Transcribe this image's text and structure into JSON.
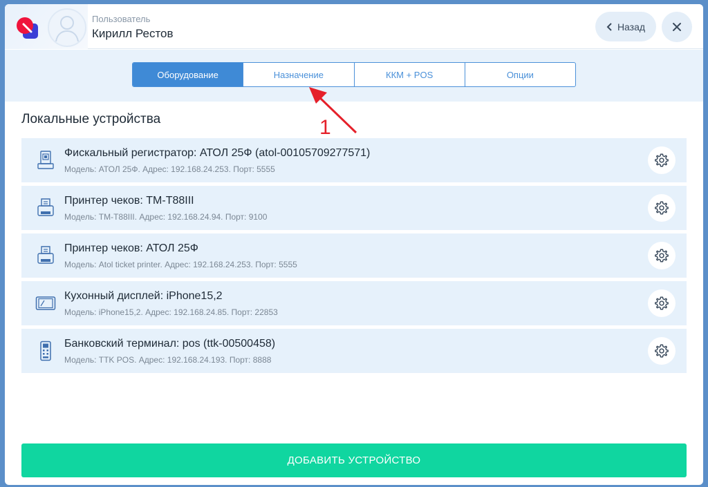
{
  "header": {
    "user_role": "Пользователь",
    "user_name": "Кирилл Рестов",
    "back_label": "Назад"
  },
  "tabs": [
    {
      "label": "Оборудование",
      "active": true
    },
    {
      "label": "Назначение",
      "active": false
    },
    {
      "label": "ККМ + POS",
      "active": false
    },
    {
      "label": "Опции",
      "active": false
    }
  ],
  "annotation": {
    "number": "1"
  },
  "section": {
    "title": "Локальные устройства"
  },
  "devices": [
    {
      "title": "Фискальный регистратор: АТОЛ 25Ф (atol-00105709277571)",
      "meta": "Модель: АТОЛ 25Ф. Адрес: 192.168.24.253. Порт: 5555",
      "icon": "fiscal-register-icon"
    },
    {
      "title": "Принтер чеков: TM-T88III",
      "meta": "Модель: TM-T88III. Адрес: 192.168.24.94. Порт: 9100",
      "icon": "receipt-printer-icon"
    },
    {
      "title": "Принтер чеков: АТОЛ 25Ф",
      "meta": "Модель: Atol ticket printer. Адрес: 192.168.24.253. Порт: 5555",
      "icon": "receipt-printer-icon"
    },
    {
      "title": "Кухонный дисплей: iPhone15,2",
      "meta": "Модель: iPhone15,2. Адрес: 192.168.24.85. Порт: 22853",
      "icon": "kitchen-display-icon"
    },
    {
      "title": "Банковский терминал: pos (ttk-00500458)",
      "meta": "Модель: TTK POS. Адрес: 192.168.24.193. Порт: 8888",
      "icon": "bank-terminal-icon"
    }
  ],
  "actions": {
    "add_device": "ДОБАВИТЬ УСТРОЙСТВО"
  },
  "colors": {
    "accent": "#3f8ad6",
    "add_button": "#10d6a0",
    "row_background": "#e6f1fb",
    "annotation": "#e5202a"
  }
}
